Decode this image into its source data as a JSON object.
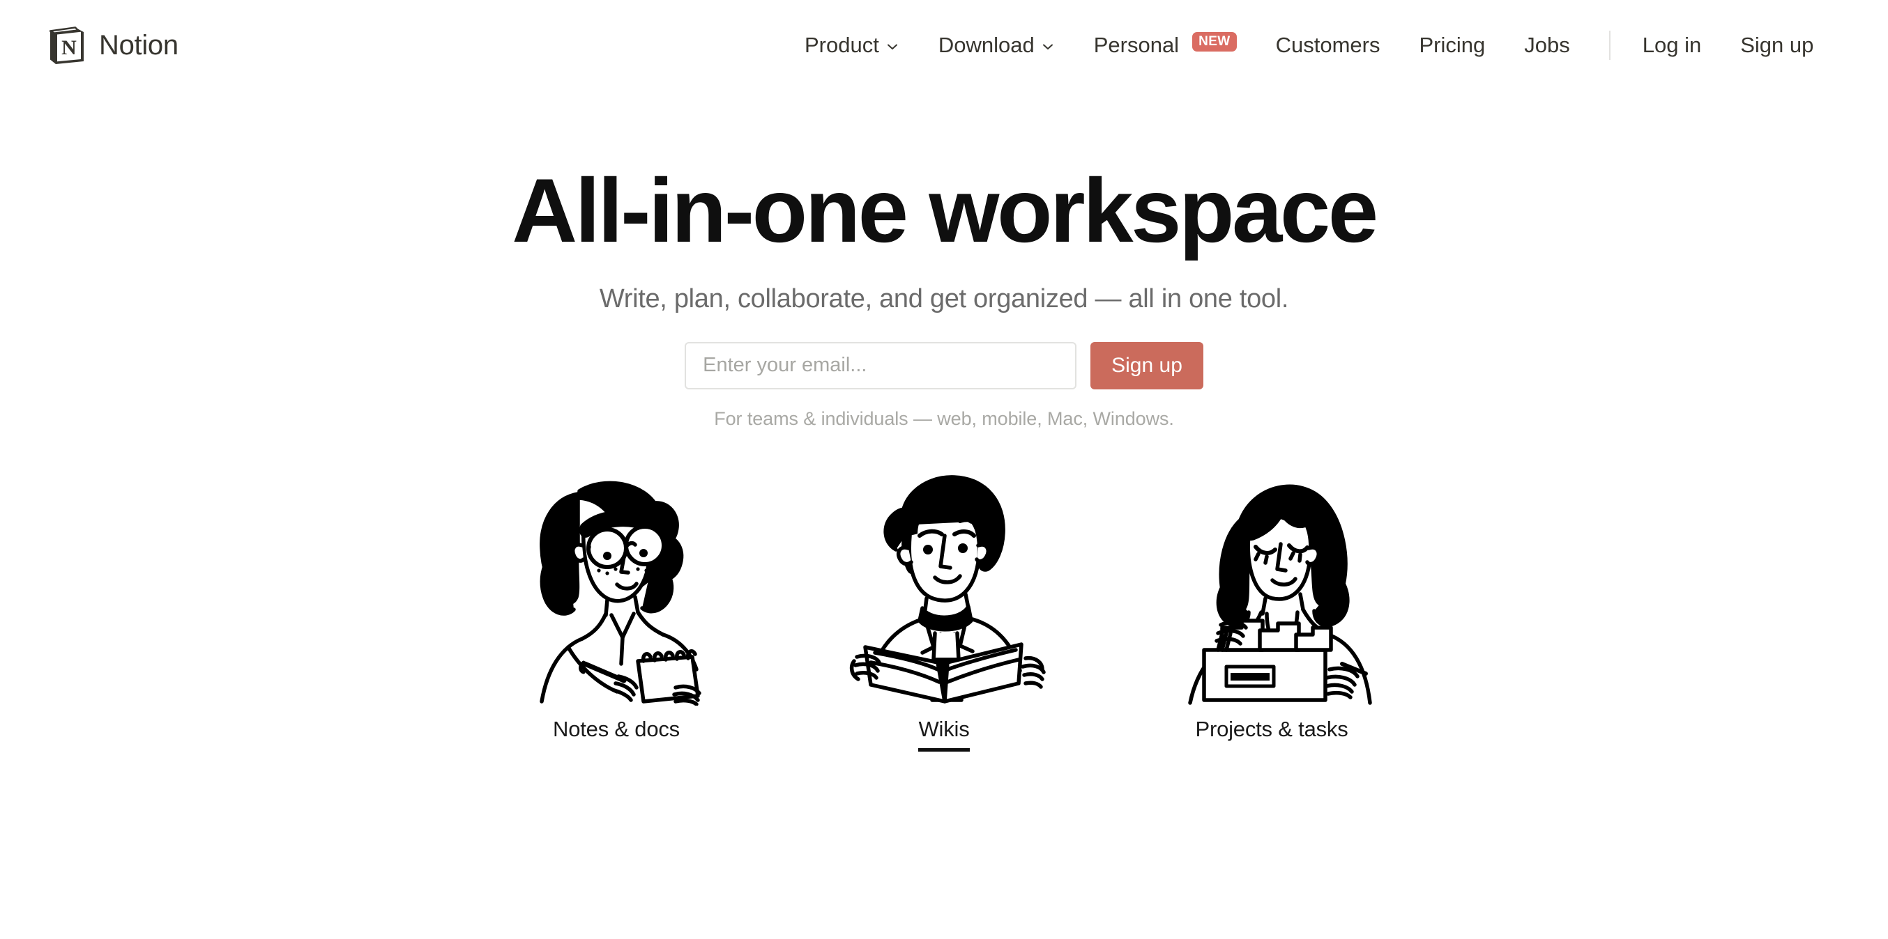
{
  "brand": {
    "name": "Notion",
    "logo_icon": "notion-logo-icon"
  },
  "nav": {
    "items": [
      {
        "label": "Product",
        "icon": "chevron-down-icon",
        "has_chevron": true,
        "badge": null
      },
      {
        "label": "Download",
        "icon": "chevron-down-icon",
        "has_chevron": true,
        "badge": null
      },
      {
        "label": "Personal",
        "icon": null,
        "has_chevron": false,
        "badge": "NEW"
      },
      {
        "label": "Customers",
        "icon": null,
        "has_chevron": false,
        "badge": null
      },
      {
        "label": "Pricing",
        "icon": null,
        "has_chevron": false,
        "badge": null
      },
      {
        "label": "Jobs",
        "icon": null,
        "has_chevron": false,
        "badge": null
      }
    ],
    "auth": [
      {
        "label": "Log in"
      },
      {
        "label": "Sign up"
      }
    ]
  },
  "hero": {
    "title": "All-in-one workspace",
    "subtitle": "Write, plan, collaborate, and get organized — all in one tool.",
    "email_placeholder": "Enter your email...",
    "email_value": "",
    "signup_label": "Sign up",
    "note": "For teams & individuals — web, mobile, Mac, Windows."
  },
  "features": [
    {
      "label": "Notes & docs",
      "icon": "person-writing-notepad-illustration",
      "active": false
    },
    {
      "label": "Wikis",
      "icon": "person-reading-book-illustration",
      "active": true
    },
    {
      "label": "Projects & tasks",
      "icon": "person-organizing-files-illustration",
      "active": false
    }
  ],
  "colors": {
    "accent": "#CB6B5C",
    "badge": "#DA6C62",
    "text": "#37352F",
    "muted": "#A9A9A5",
    "border": "#E2E2E0"
  }
}
